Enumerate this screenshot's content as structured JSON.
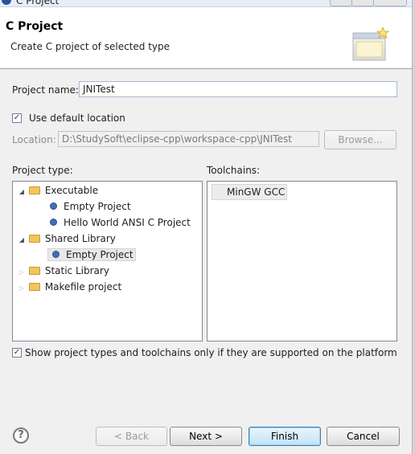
{
  "window": {
    "title": "C Project"
  },
  "header": {
    "title": "C Project",
    "description": "Create C project of selected type",
    "image_icon": "wizard-banner-icon"
  },
  "form": {
    "project_name_label": "Project name:",
    "project_name_value": "JNITest",
    "use_default_label": "Use default location",
    "use_default_checked": true,
    "location_label": "Location:",
    "location_value": "D:\\StudySoft\\eclipse-cpp\\workspace-cpp\\JNITest",
    "browse_label": "Browse..."
  },
  "project_type": {
    "label": "Project type:",
    "items": [
      {
        "label": "Executable",
        "kind": "folder",
        "level": 0,
        "expanded": true
      },
      {
        "label": "Empty Project",
        "kind": "item",
        "level": 1
      },
      {
        "label": "Hello World ANSI C Project",
        "kind": "item",
        "level": 1
      },
      {
        "label": "Shared Library",
        "kind": "folder",
        "level": 0,
        "expanded": true
      },
      {
        "label": "Empty Project",
        "kind": "item",
        "level": 1,
        "selected": true
      },
      {
        "label": "Static Library",
        "kind": "folder",
        "level": 0,
        "expanded": false
      },
      {
        "label": "Makefile project",
        "kind": "folder",
        "level": 0,
        "expanded": false
      }
    ]
  },
  "toolchains": {
    "label": "Toolchains:",
    "items": [
      "MinGW GCC"
    ]
  },
  "filter": {
    "label": "Show project types and toolchains only if they are supported on the platform",
    "checked": true
  },
  "buttons": {
    "back": "< Back",
    "next": "Next >",
    "finish": "Finish",
    "cancel": "Cancel",
    "help": "?"
  },
  "colors": {
    "header_bg": "#ffffff",
    "dialog_bg": "#f0f0f0",
    "default_button_border": "#3c7fb1"
  }
}
